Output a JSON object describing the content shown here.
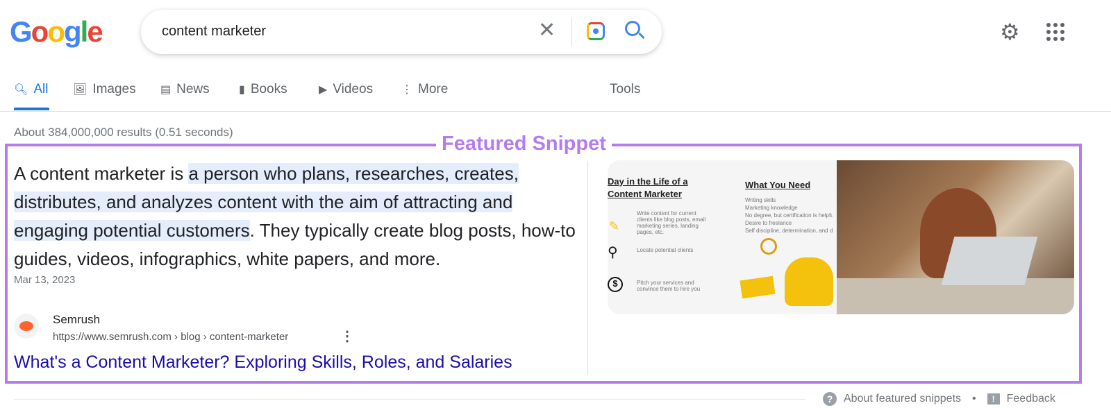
{
  "logo": "Google",
  "search": {
    "query": "content marketer"
  },
  "tabs": [
    {
      "label": "All",
      "icon": "search-icon"
    },
    {
      "label": "Images",
      "icon": "image-icon"
    },
    {
      "label": "News",
      "icon": "news-icon"
    },
    {
      "label": "Books",
      "icon": "book-icon"
    },
    {
      "label": "Videos",
      "icon": "video-icon"
    },
    {
      "label": "More",
      "icon": "more-vert-icon"
    }
  ],
  "tools": "Tools",
  "stats": "About 384,000,000 results (0.51 seconds)",
  "annotation": {
    "label": "Featured Snippet",
    "color": "#b57cf0"
  },
  "snippet": {
    "pre": "A content marketer is ",
    "highlight": "a person who plans, researches, creates, distributes, and analyzes content with the aim of attracting and engaging potential customers",
    "post": ". They typically create blog posts, how-to guides, videos, infographics, white papers, and more.",
    "date": "Mar 13, 2023"
  },
  "source": {
    "site": "Semrush",
    "url": "https://www.semrush.com › blog › content-marketer",
    "title": "What's a Content Marketer? Exploring Skills, Roles, and Salaries"
  },
  "infographic": {
    "heading1": "Day in the Life of a Content Marketer",
    "items": [
      "Write content for current clients like blog posts, email marketing series, landing pages, etc.",
      "Locate potential clients",
      "Pitch your services and convince them to hire you"
    ],
    "heading2": "What You Need",
    "needs": [
      "Writing skills",
      "Marketing knowledge",
      "No degree, but certification is helpful",
      "Desire to freelance",
      "Self discipline, determination, and d"
    ]
  },
  "footer": {
    "about": "About featured snippets",
    "sep": "•",
    "feedback": "Feedback"
  }
}
